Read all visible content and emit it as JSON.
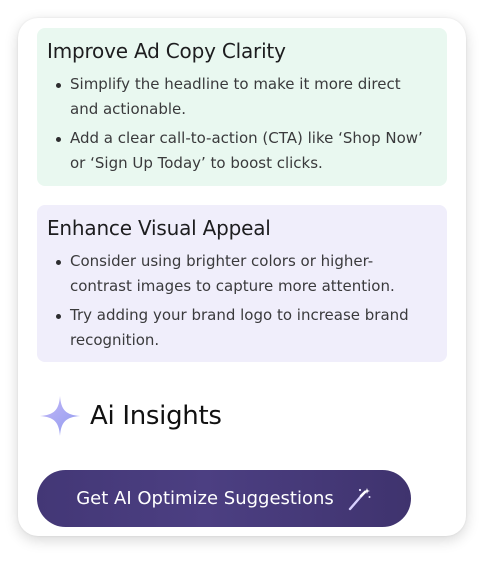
{
  "tips": [
    {
      "title": "Improve Ad Copy Clarity",
      "bullets": [
        "Simplify the headline to make it more direct and actionable.",
        "Add a clear call-to-action (CTA) like ‘Shop Now’ or ‘Sign Up Today’ to boost clicks."
      ]
    },
    {
      "title": "Enhance Visual Appeal",
      "bullets": [
        "Consider using brighter colors or higher-contrast images to capture more attention.",
        "Try adding your brand logo to increase brand recognition."
      ]
    }
  ],
  "insights": {
    "title": "Ai Insights",
    "icon": "sparkle-icon"
  },
  "cta": {
    "label": "Get AI Optimize Suggestions",
    "icon": "magic-wand-icon"
  },
  "colors": {
    "tip_green_bg": "#e9f8f0",
    "tip_purple_bg": "#f0eefb",
    "cta_bg": "#433776",
    "sparkle": "#a8a0f0"
  }
}
